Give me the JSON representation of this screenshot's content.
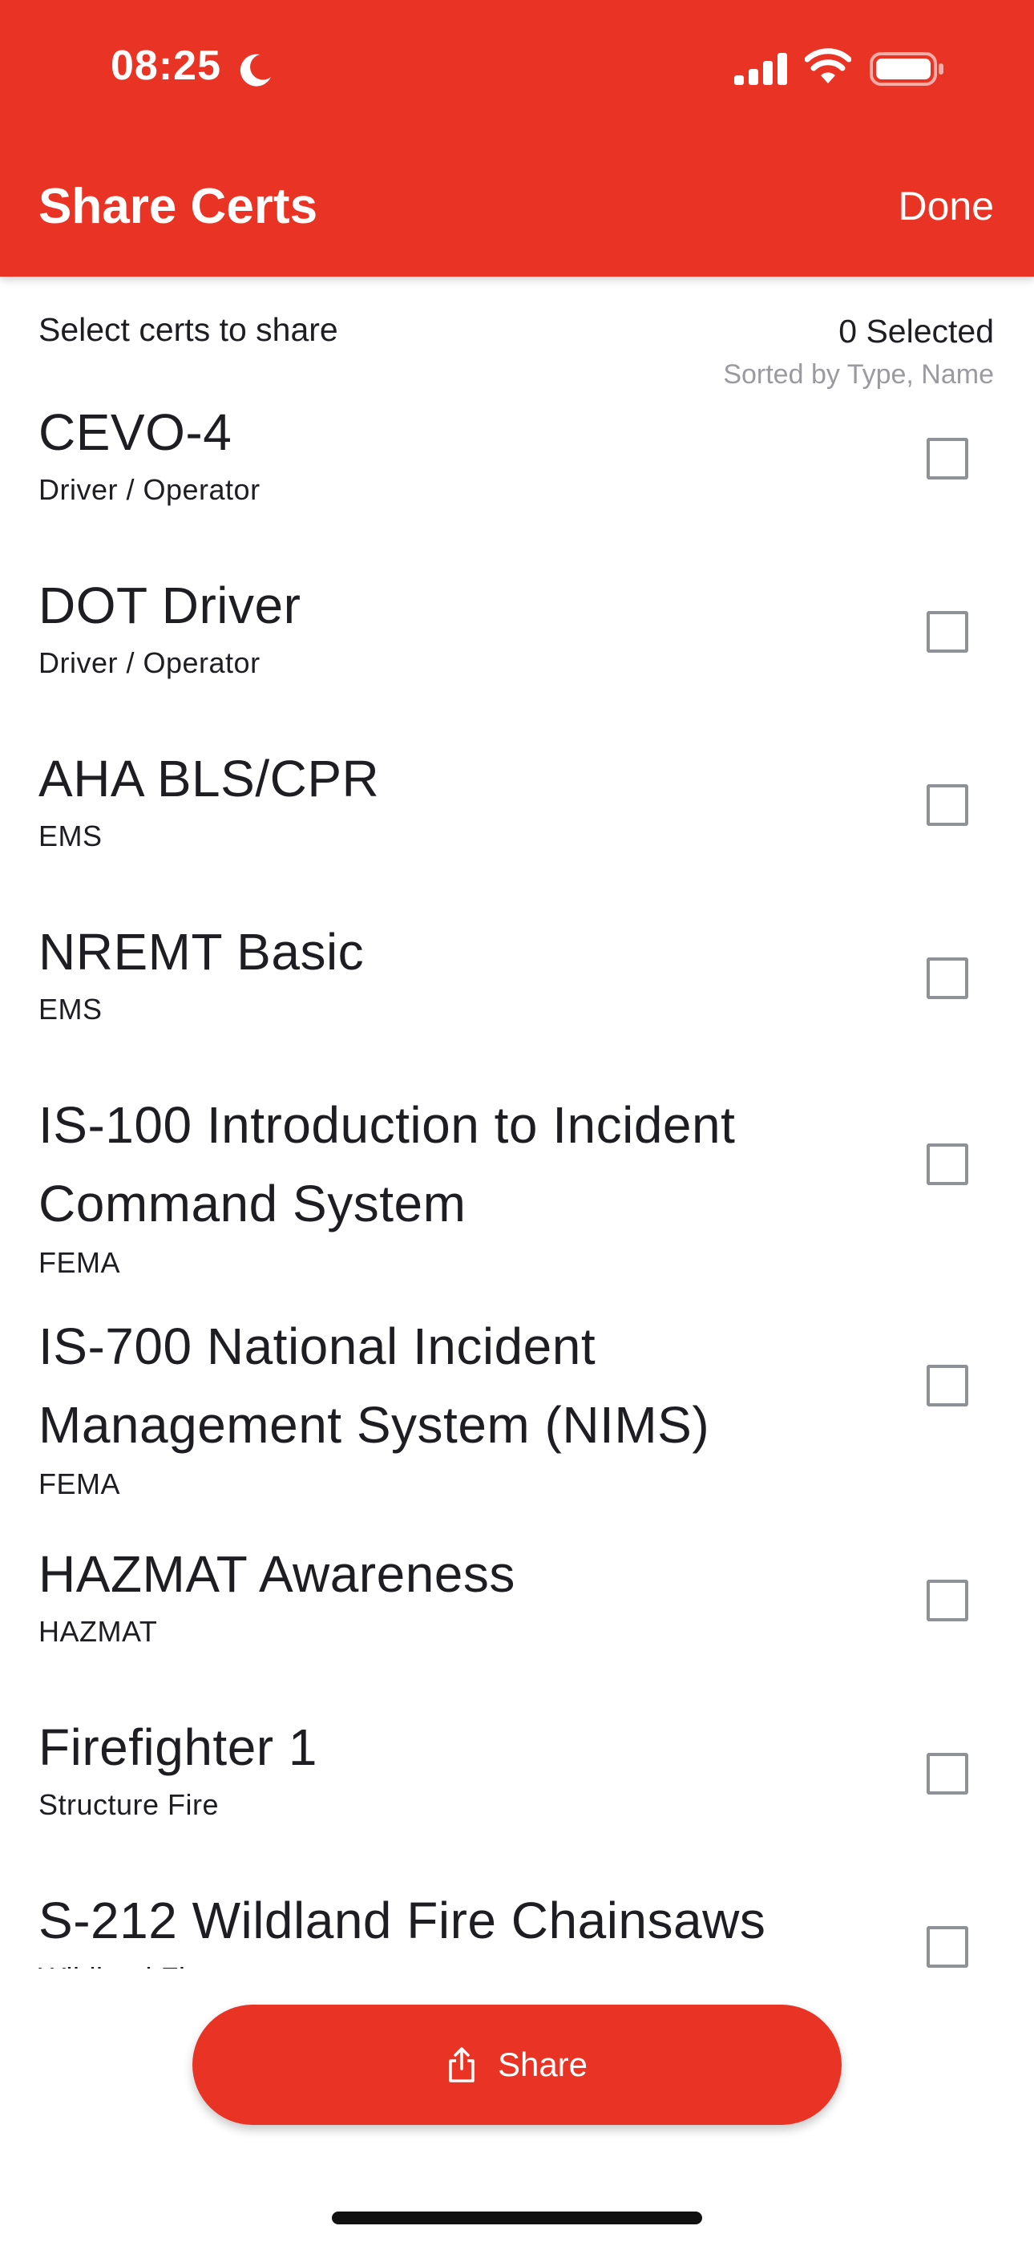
{
  "status_bar": {
    "time": "08:25"
  },
  "nav": {
    "title": "Share Certs",
    "done_label": "Done"
  },
  "subheader": {
    "prompt": "Select certs to share",
    "selected_count": "0 Selected",
    "sort_label": "Sorted by Type, Name"
  },
  "certs": [
    {
      "name": "CEVO-4",
      "type": "Driver / Operator",
      "checked": false
    },
    {
      "name": "DOT Driver",
      "type": "Driver / Operator",
      "checked": false
    },
    {
      "name": "AHA BLS/CPR",
      "type": "EMS",
      "checked": false
    },
    {
      "name": "NREMT Basic",
      "type": "EMS",
      "checked": false
    },
    {
      "name": "IS-100 Introduction to Incident Command System",
      "type": "FEMA",
      "checked": false
    },
    {
      "name": "IS-700 National Incident Management System (NIMS)",
      "type": "FEMA",
      "checked": false
    },
    {
      "name": "HAZMAT Awareness",
      "type": "HAZMAT",
      "checked": false
    },
    {
      "name": "Firefighter 1",
      "type": "Structure Fire",
      "checked": false
    },
    {
      "name": "S-212 Wildland Fire Chainsaws",
      "type": "Wildland Fire",
      "checked": false
    }
  ],
  "share_button": {
    "label": "Share",
    "icon": "share-icon"
  },
  "colors": {
    "accent": "#e93325",
    "checkbox_border": "#8e9196",
    "muted_text": "#9a9a9f"
  }
}
